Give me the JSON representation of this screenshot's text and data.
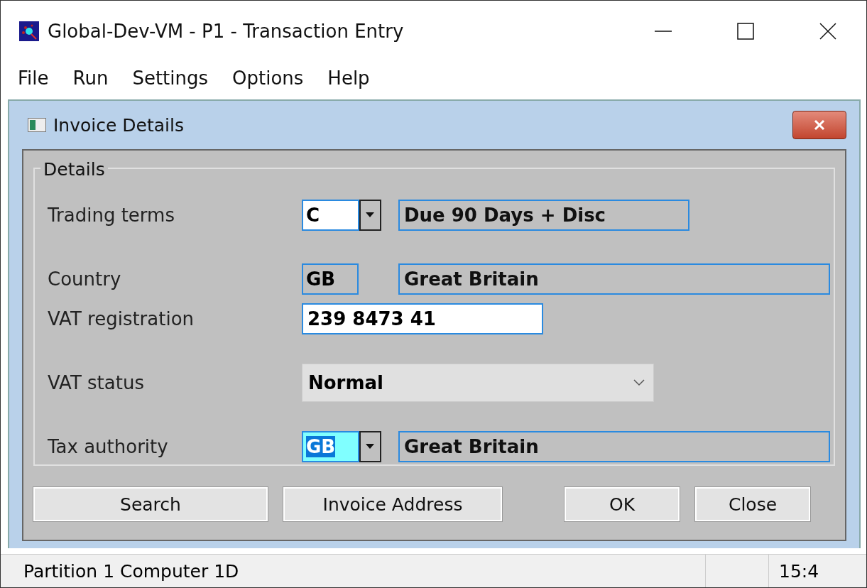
{
  "window": {
    "title": "Global-Dev-VM - P1 - Transaction Entry"
  },
  "menu": [
    "File",
    "Run",
    "Settings",
    "Options",
    "Help"
  ],
  "dialog": {
    "title": "Invoice Details",
    "group": "Details",
    "rows": [
      {
        "label": "Trading terms",
        "kind": "combo",
        "value": "C",
        "selected": false,
        "description": "Due 90 Days + Disc"
      },
      {
        "label": "Country",
        "kind": "code",
        "value": "GB",
        "description": "Great Britain"
      },
      {
        "label": "VAT registration",
        "kind": "input",
        "value": "239 8473 41"
      },
      {
        "label": "VAT status",
        "kind": "select",
        "value": "Normal"
      },
      {
        "label": "Tax authority",
        "kind": "combo",
        "value": "GB",
        "selected": true,
        "description": "Great Britain"
      }
    ],
    "buttons": [
      "Search",
      "Invoice Address",
      "OK",
      "Close"
    ]
  },
  "status_bar": [
    "Partition 1 Computer 1D",
    "15:4"
  ]
}
